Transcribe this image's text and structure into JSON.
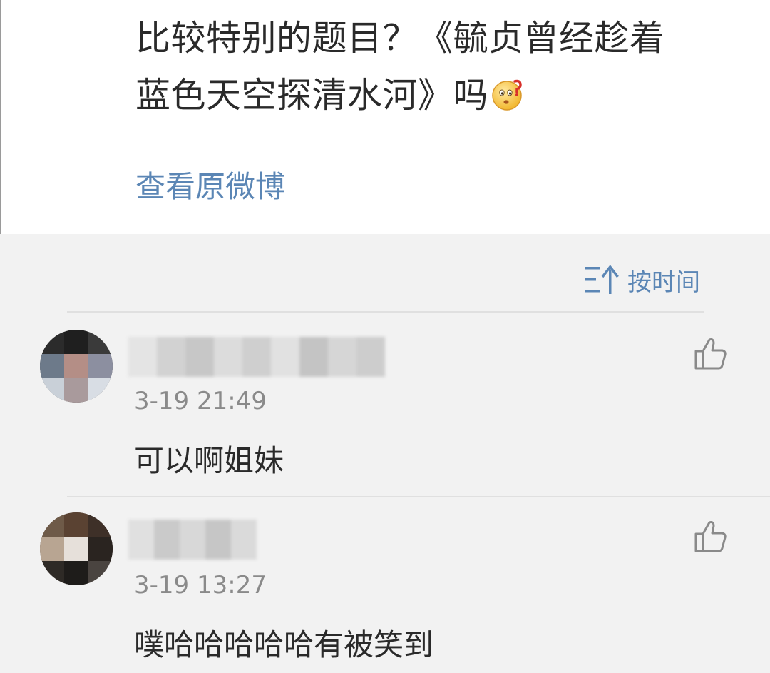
{
  "post": {
    "text_line1": "比较特别的题目？《毓贞曾经趁着",
    "text_line2": "蓝色天空探清水河》吗",
    "emoji": "thinking-face-emoji",
    "view_original": "查看原微博"
  },
  "sort": {
    "label": "按时间",
    "icon": "sort-ascending-icon"
  },
  "comments": [
    {
      "timestamp": "3-19 21:49",
      "text": "可以啊姐妹",
      "like_icon": "thumbs-up-icon"
    },
    {
      "timestamp": "3-19 13:27",
      "text": "噗哈哈哈哈哈有被笑到",
      "like_icon": "thumbs-up-icon"
    }
  ],
  "colors": {
    "link": "#5b86b5",
    "text": "#2a2a2a",
    "meta": "#8a8a8a",
    "background": "#f2f2f2"
  }
}
